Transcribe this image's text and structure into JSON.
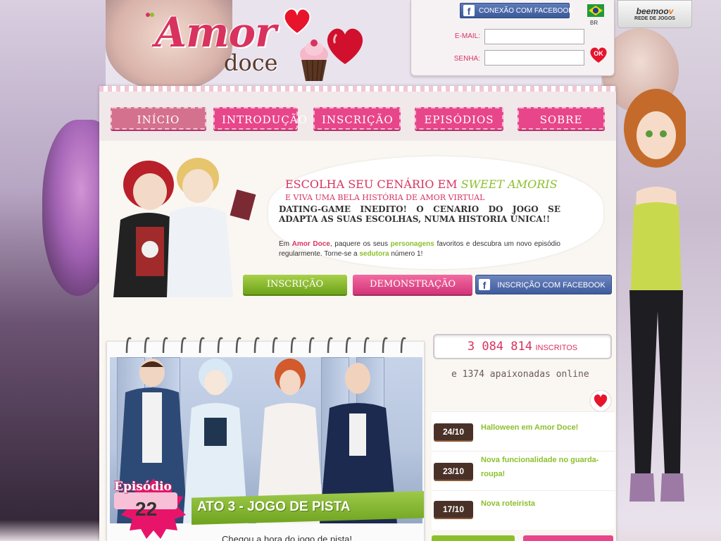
{
  "brand": {
    "logo_word_1": "Amor",
    "logo_word_2": "doce",
    "accent": "#d8335f",
    "green": "#8cbf2c"
  },
  "login": {
    "facebook_label": "CONEXÃO COM FACEBOOK",
    "flag_label": "BR",
    "email_label": "E-MAIL:",
    "password_label": "SENHA:",
    "email_value": "",
    "password_value": "",
    "ok_label": "OK"
  },
  "network": {
    "name_1": "beemoo",
    "name_2": "v",
    "subtitle": "REDE DE JOGOS"
  },
  "nav": {
    "items": [
      {
        "label": "INÍCIO"
      },
      {
        "label": "INTRODUÇÃO"
      },
      {
        "label": "INSCRIÇÃO"
      },
      {
        "label": "EPISÓDIOS"
      },
      {
        "label": "SOBRE"
      }
    ]
  },
  "banner": {
    "headline_start": "ESCOLHA SEU CENÁRIO EM ",
    "headline_highlight": "SWEET AMORIS",
    "subheadline": "E VIVA UMA BELA HISTÓRIA DE AMOR VIRTUAL",
    "tagline": "DATING-GAME INEDITO! O CENARIO DO JOGO SE ADAPTA AS SUAS ESCOLHAS, NUMA HISTORIA ÚNICA!!",
    "desc_1": "Em ",
    "desc_brand": "Amor Doce",
    "desc_2": ", paquere os seus ",
    "desc_personagens": "personagens",
    "desc_3": " favoritos e descubra um novo episódio regularmente. Torne-se a ",
    "desc_sedutora": "sedutora",
    "desc_4": " número 1!",
    "cta_signup": "INSCRIÇÃO",
    "cta_demo": "DEMONSTRAÇÃO",
    "cta_facebook": "INSCRIÇÃO COM FACEBOOK"
  },
  "episode": {
    "label": "Episódio",
    "number": "22",
    "title": "ATO 3 - JOGO DE PISTA",
    "teaser": "Chegou a hora do jogo de pista!"
  },
  "stats": {
    "subscribers": "3 084 814",
    "subscribers_label": "INSCRITOS",
    "online_text": "e 1374 apaixonadas online"
  },
  "news": [
    {
      "date": "24/10",
      "title": "Halloween em Amor Doce!"
    },
    {
      "date": "23/10",
      "title": "Nova funcionalidade no guarda-roupa!"
    },
    {
      "date": "17/10",
      "title": "Nova roteirista"
    }
  ]
}
